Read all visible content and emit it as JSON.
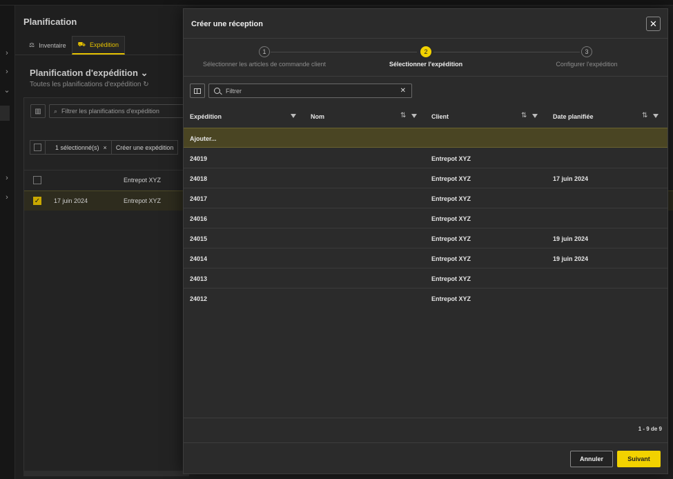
{
  "background": {
    "title": "Planification",
    "tabs": [
      {
        "label": "Inventaire",
        "icon": "boxes-icon"
      },
      {
        "label": "Expédition",
        "icon": "truck-icon"
      }
    ],
    "subtitle": "Planification d'expédition",
    "subtitle_caption": "Toutes les planifications d'expédition",
    "filter_placeholder": "Filtrer les planifications d'expédition",
    "selection_count": "1 sélectionné(s)",
    "selection_action": "Créer une expédition",
    "rows": [
      {
        "date": "",
        "client": "Entrepot XYZ",
        "selected": false
      },
      {
        "date": "17 juin 2024",
        "client": "Entrepot XYZ",
        "selected": true
      }
    ]
  },
  "modal": {
    "title": "Créer une réception",
    "steps": [
      {
        "num": "1",
        "label": "Sélectionner les articles de commande client"
      },
      {
        "num": "2",
        "label": "Sélectionner l'expédition"
      },
      {
        "num": "3",
        "label": "Configurer l'expédition"
      }
    ],
    "active_step": 2,
    "filter_placeholder": "Filtrer",
    "columns": [
      "Expédition",
      "Nom",
      "Client",
      "Date planifiée"
    ],
    "add_row_label": "Ajouter...",
    "rows": [
      {
        "expedition": "24019",
        "nom": "",
        "client": "Entrepot XYZ",
        "date": ""
      },
      {
        "expedition": "24018",
        "nom": "",
        "client": "Entrepot XYZ",
        "date": "17 juin 2024"
      },
      {
        "expedition": "24017",
        "nom": "",
        "client": "Entrepot XYZ",
        "date": ""
      },
      {
        "expedition": "24016",
        "nom": "",
        "client": "Entrepot XYZ",
        "date": ""
      },
      {
        "expedition": "24015",
        "nom": "",
        "client": "Entrepot XYZ",
        "date": "19 juin 2024"
      },
      {
        "expedition": "24014",
        "nom": "",
        "client": "Entrepot XYZ",
        "date": "19 juin 2024"
      },
      {
        "expedition": "24013",
        "nom": "",
        "client": "Entrepot XYZ",
        "date": ""
      },
      {
        "expedition": "24012",
        "nom": "",
        "client": "Entrepot XYZ",
        "date": ""
      }
    ],
    "pagination": "1 - 9 de 9",
    "cancel_label": "Annuler",
    "next_label": "Suivant",
    "accent_color": "#f2d200"
  }
}
